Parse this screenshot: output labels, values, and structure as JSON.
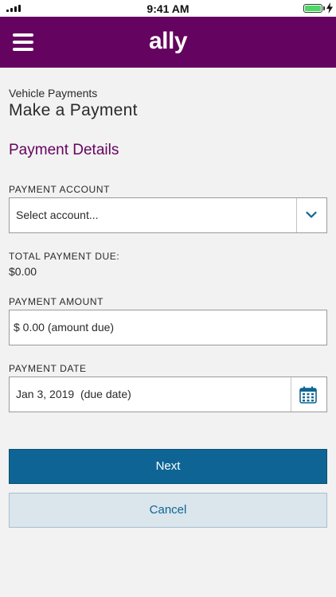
{
  "status_bar": {
    "time": "9:41 AM"
  },
  "header": {
    "logo": "ally",
    "menu_icon": "hamburger-menu-icon"
  },
  "breadcrumb": "Vehicle Payments",
  "page_title": "Make a Payment",
  "section_title": "Payment Details",
  "payment_account": {
    "label": "PAYMENT ACCOUNT",
    "selected": "Select account...",
    "icon": "chevron-down-icon"
  },
  "total_due": {
    "label": "TOTAL PAYMENT DUE:",
    "value": "$0.00"
  },
  "payment_amount": {
    "label": "PAYMENT AMOUNT",
    "value": "$ 0.00 (amount due)"
  },
  "payment_date": {
    "label": "PAYMENT DATE",
    "value": "Jan 3, 2019  (due date)",
    "icon": "calendar-icon"
  },
  "buttons": {
    "next": "Next",
    "cancel": "Cancel"
  },
  "colors": {
    "brand": "#650360",
    "primary_button": "#0e6595",
    "secondary_button": "#dae5ec"
  }
}
